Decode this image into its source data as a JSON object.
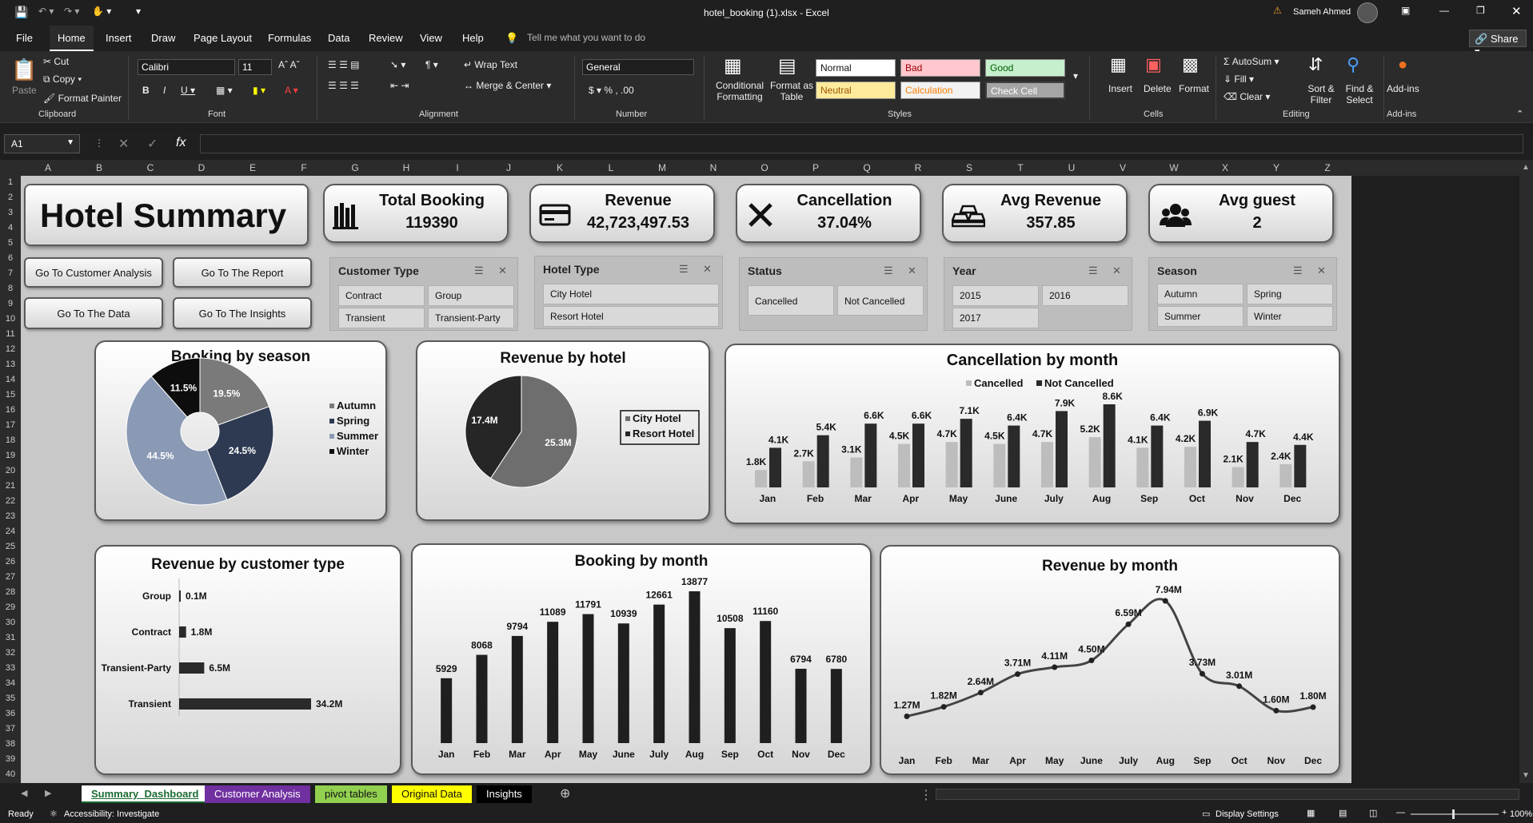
{
  "window": {
    "title": "hotel_booking (1).xlsx  -  Excel",
    "user": "Sameh Ahmed",
    "share": "Share"
  },
  "tabs": [
    "File",
    "Home",
    "Insert",
    "Draw",
    "Page Layout",
    "Formulas",
    "Data",
    "Review",
    "View",
    "Help"
  ],
  "tell_me": "Tell me what you want to do",
  "ribbon": {
    "clipboard": {
      "paste": "Paste",
      "cut": "Cut",
      "copy": "Copy",
      "format_painter": "Format Painter",
      "group": "Clipboard"
    },
    "font": {
      "name": "Calibri",
      "size": "11",
      "group": "Font"
    },
    "alignment": {
      "wrap": "Wrap Text",
      "merge": "Merge & Center",
      "group": "Alignment"
    },
    "number": {
      "format": "General",
      "group": "Number"
    },
    "styles": {
      "cond": "Conditional Formatting",
      "table": "Format as Table",
      "normal": "Normal",
      "bad": "Bad",
      "good": "Good",
      "neutral": "Neutral",
      "calculation": "Calculation",
      "check": "Check Cell",
      "group": "Styles"
    },
    "cells": {
      "insert": "Insert",
      "delete": "Delete",
      "format": "Format",
      "group": "Cells"
    },
    "editing": {
      "autosum": "AutoSum",
      "fill": "Fill",
      "clear": "Clear",
      "sort": "Sort & Filter",
      "find": "Find & Select",
      "group": "Editing"
    },
    "addins": {
      "label": "Add-ins",
      "group": "Add-ins"
    }
  },
  "namebox": "A1",
  "columns": [
    "A",
    "B",
    "C",
    "D",
    "E",
    "F",
    "G",
    "H",
    "I",
    "J",
    "K",
    "L",
    "M",
    "N",
    "O",
    "P",
    "Q",
    "R",
    "S",
    "T",
    "U",
    "V",
    "W",
    "X",
    "Y",
    "Z"
  ],
  "dashboard": {
    "title": "Hotel Summary",
    "kpis": [
      {
        "title": "Total Booking",
        "value": "119390",
        "icon": "books-icon"
      },
      {
        "title": "Revenue",
        "value": "42,723,497.53",
        "icon": "credit-card-icon"
      },
      {
        "title": "Cancellation",
        "value": "37.04%",
        "icon": "x-icon"
      },
      {
        "title": "Avg Revenue",
        "value": "357.85",
        "icon": "gold-bars-icon"
      },
      {
        "title": "Avg guest",
        "value": "2",
        "icon": "group-icon"
      }
    ],
    "nav_buttons": [
      "Go To Customer Analysis",
      "Go To The Report",
      "Go To The Data",
      "Go To The Insights"
    ],
    "slicers": [
      {
        "title": "Customer Type",
        "items": [
          "Contract",
          "Group",
          "Transient",
          "Transient-Party"
        ]
      },
      {
        "title": "Hotel Type",
        "items": [
          "City Hotel",
          "Resort Hotel"
        ]
      },
      {
        "title": "Status",
        "items": [
          "Cancelled",
          "Not Cancelled"
        ]
      },
      {
        "title": "Year",
        "items": [
          "2015",
          "2016",
          "2017"
        ]
      },
      {
        "title": "Season",
        "items": [
          "Autumn",
          "Spring",
          "Summer",
          "Winter"
        ]
      }
    ]
  },
  "chart_data": [
    {
      "type": "pie",
      "title": "Booking by season",
      "categories": [
        "Autumn",
        "Spring",
        "Summer",
        "Winter"
      ],
      "values": [
        19.5,
        24.5,
        44.5,
        11.5
      ],
      "labels": [
        "19.5%",
        "24.5%",
        "44.5%",
        "11.5%"
      ],
      "colors": [
        "#7a7a7a",
        "#2e3a52",
        "#8a9ab5",
        "#0d0d0d"
      ],
      "legend": "right"
    },
    {
      "type": "pie",
      "title": "Revenue by hotel",
      "categories": [
        "City Hotel",
        "Resort Hotel"
      ],
      "values": [
        25.3,
        17.4
      ],
      "labels": [
        "25.3M",
        "17.4M"
      ],
      "colors": [
        "#6e6e6e",
        "#262626"
      ],
      "legend": "right"
    },
    {
      "type": "bar",
      "title": "Cancellation by month",
      "categories": [
        "Jan",
        "Feb",
        "Mar",
        "Apr",
        "May",
        "June",
        "July",
        "Aug",
        "Sep",
        "Oct",
        "Nov",
        "Dec"
      ],
      "series": [
        {
          "name": "Cancelled",
          "values": [
            1.8,
            2.7,
            3.1,
            4.5,
            4.7,
            4.5,
            4.7,
            5.2,
            4.1,
            4.2,
            2.1,
            2.4
          ],
          "labels": [
            "1.8K",
            "2.7K",
            "3.1K",
            "4.5K",
            "4.7K",
            "4.5K",
            "4.7K",
            "5.2K",
            "4.1K",
            "4.2K",
            "2.1K",
            "2.4K"
          ],
          "color": "#bdbdbd"
        },
        {
          "name": "Not Cancelled",
          "values": [
            4.1,
            5.4,
            6.6,
            6.6,
            7.1,
            6.4,
            7.9,
            8.6,
            6.4,
            6.9,
            4.7,
            4.4
          ],
          "labels": [
            "4.1K",
            "5.4K",
            "6.6K",
            "6.6K",
            "7.1K",
            "6.4K",
            "7.9K",
            "8.6K",
            "6.4K",
            "6.9K",
            "4.7K",
            "4.4K"
          ],
          "color": "#2a2a2a"
        }
      ],
      "legend": "top"
    },
    {
      "type": "bar",
      "title": "Revenue by customer type",
      "orientation": "horizontal",
      "categories": [
        "Group",
        "Contract",
        "Transient-Party",
        "Transient"
      ],
      "values": [
        0.1,
        1.8,
        6.5,
        34.2
      ],
      "labels": [
        "0.1M",
        "1.8M",
        "6.5M",
        "34.2M"
      ]
    },
    {
      "type": "bar",
      "title": "Booking by month",
      "categories": [
        "Jan",
        "Feb",
        "Mar",
        "Apr",
        "May",
        "June",
        "July",
        "Aug",
        "Sep",
        "Oct",
        "Nov",
        "Dec"
      ],
      "values": [
        5929,
        8068,
        9794,
        11089,
        11791,
        10939,
        12661,
        13877,
        10508,
        11160,
        6794,
        6780
      ]
    },
    {
      "type": "line",
      "title": "Revenue by month",
      "categories": [
        "Jan",
        "Feb",
        "Mar",
        "Apr",
        "May",
        "June",
        "July",
        "Aug",
        "Sep",
        "Oct",
        "Nov",
        "Dec"
      ],
      "values": [
        1.27,
        1.82,
        2.64,
        3.71,
        4.11,
        4.5,
        6.59,
        7.94,
        3.73,
        3.01,
        1.6,
        1.8
      ],
      "labels": [
        "1.27M",
        "1.82M",
        "2.64M",
        "3.71M",
        "4.11M",
        "4.50M",
        "6.59M",
        "7.94M",
        "3.73M",
        "3.01M",
        "1.60M",
        "1.80M"
      ]
    }
  ],
  "sheets": [
    "Summary_Dashboard",
    "Customer Analysis",
    "pivot tables",
    "Original Data",
    "Insights"
  ],
  "status": {
    "ready": "Ready",
    "accessibility": "Accessibility: Investigate",
    "display": "Display Settings",
    "zoom": "100%"
  }
}
